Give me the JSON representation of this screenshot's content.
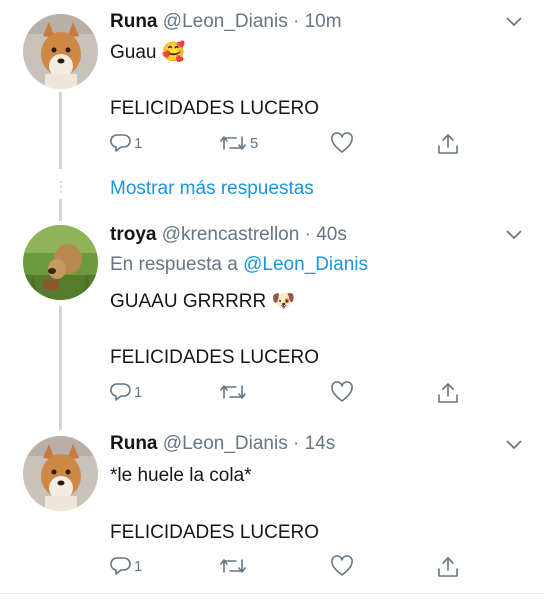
{
  "tweets": [
    {
      "name": "Runa",
      "handle": "@Leon_Dianis",
      "time": "· 10m",
      "reply_to_prefix": "",
      "reply_to_handle": "",
      "text1": "Guau",
      "text1_emoji": "🥰",
      "text2": "FELICIDADES LUCERO",
      "reply_count": "1",
      "retweet_count": "5",
      "like_count": ""
    },
    {
      "name": "troya",
      "handle": "@krencastrellon",
      "time": "· 40s",
      "reply_to_prefix": "En respuesta a",
      "reply_to_handle": "@Leon_Dianis",
      "text1": "GUAAU GRRRRR",
      "text1_emoji": "🐶",
      "text2": "FELICIDADES LUCERO",
      "reply_count": "1",
      "retweet_count": "",
      "like_count": ""
    },
    {
      "name": "Runa",
      "handle": "@Leon_Dianis",
      "time": "· 14s",
      "reply_to_prefix": "",
      "reply_to_handle": "",
      "text1": "*le huele la cola*",
      "text1_emoji": "",
      "text2": "FELICIDADES LUCERO",
      "reply_count": "1",
      "retweet_count": "",
      "like_count": ""
    }
  ],
  "show_more_replies": "Mostrar más respuestas",
  "icons": {
    "reply": "reply-icon",
    "retweet": "retweet-icon",
    "like": "heart-icon",
    "share": "share-icon",
    "menu": "chevron-down-icon"
  },
  "colors": {
    "text": "#14171a",
    "muted": "#657786",
    "link": "#1b95e0",
    "thread_line": "#ccd6dd"
  }
}
